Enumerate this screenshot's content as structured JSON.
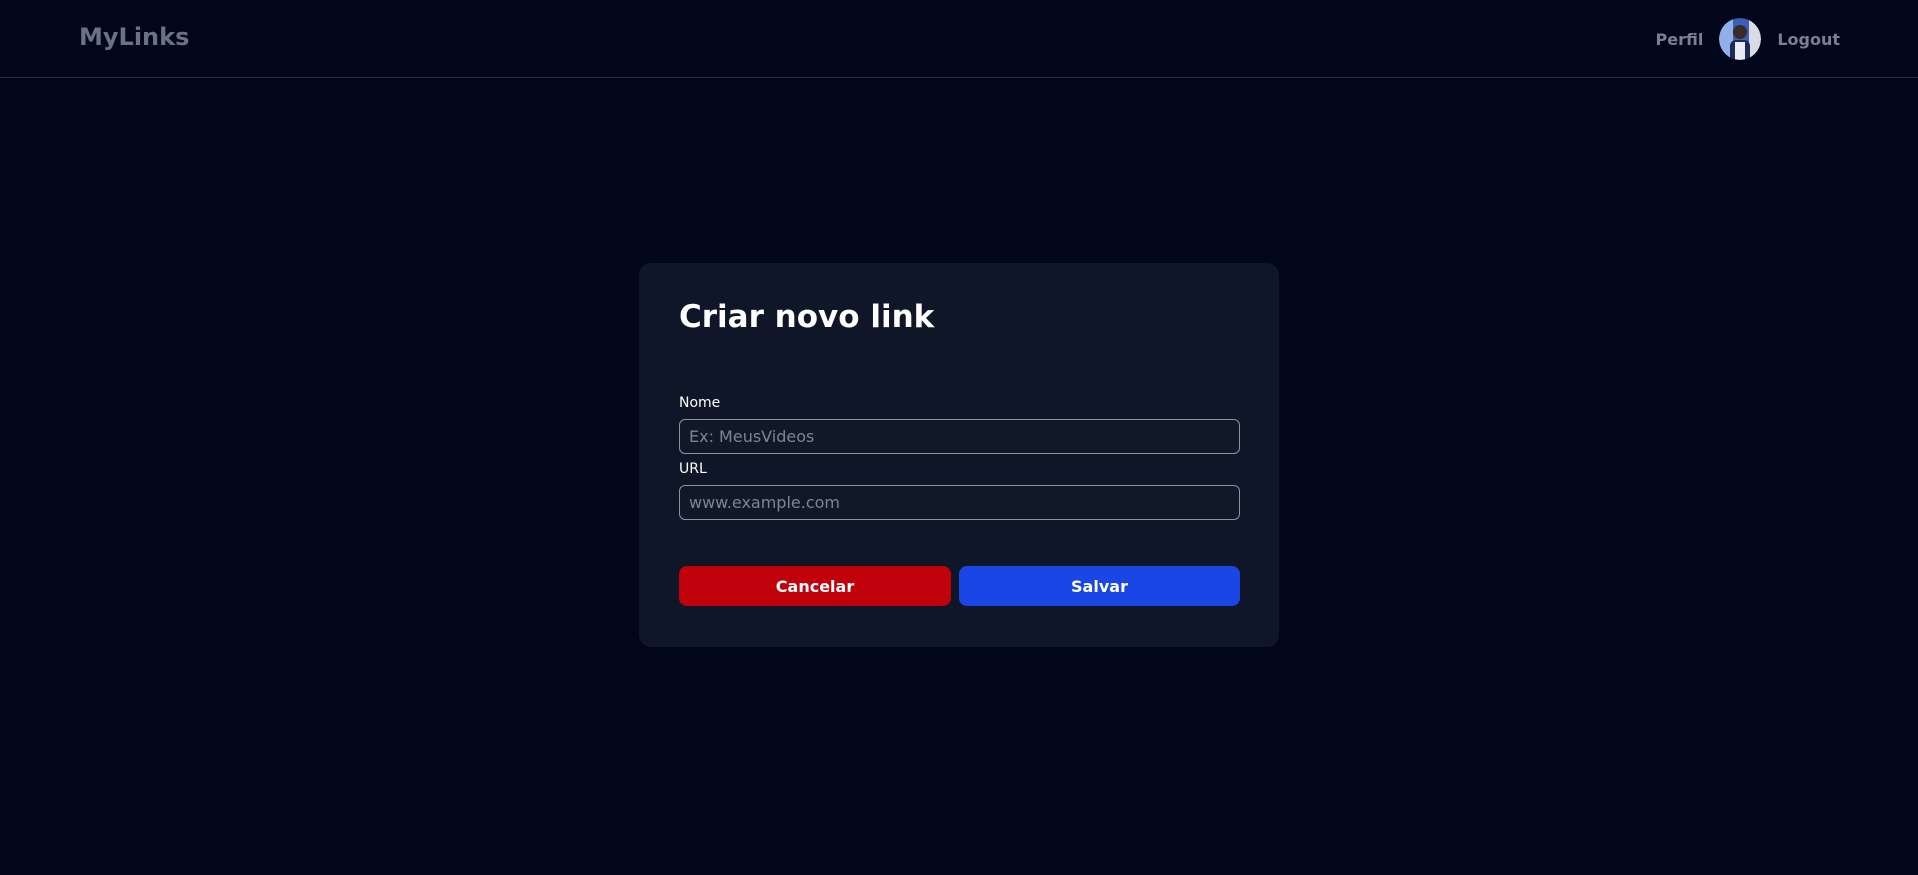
{
  "header": {
    "logo": "MyLinks",
    "nav": {
      "profile_label": "Perfil",
      "logout_label": "Logout",
      "avatar_icon": "user-avatar"
    }
  },
  "form": {
    "title": "Criar novo link",
    "fields": {
      "name": {
        "label": "Nome",
        "value": "",
        "placeholder": "Ex: MeusVideos"
      },
      "url": {
        "label": "URL",
        "value": "",
        "placeholder": "www.example.com"
      }
    },
    "buttons": {
      "cancel_label": "Cancelar",
      "save_label": "Salvar"
    }
  },
  "colors": {
    "background": "#02061a",
    "card": "#0f1628",
    "cancel": "#c0000a",
    "save": "#1a46e5"
  }
}
